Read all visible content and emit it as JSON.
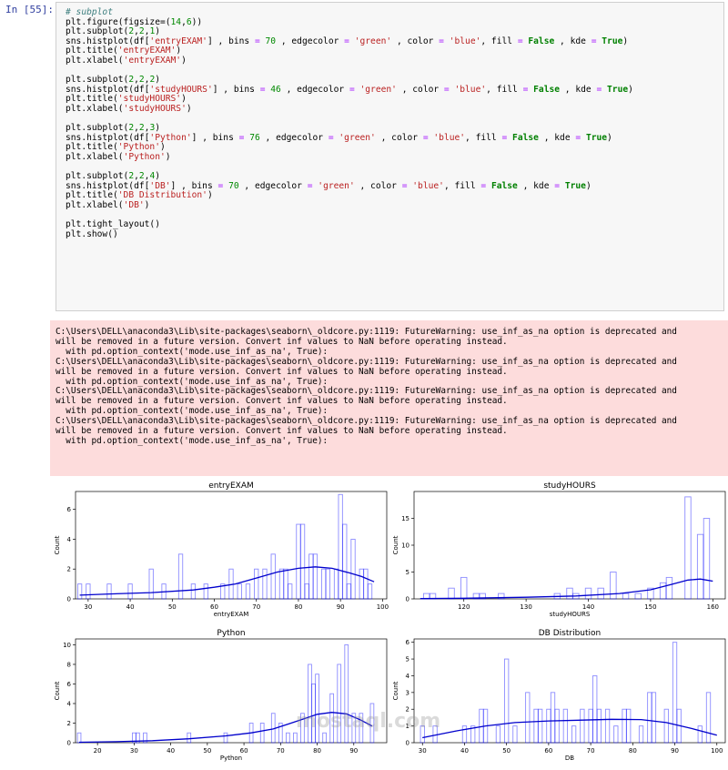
{
  "cell": {
    "prompt": "In [55]:",
    "code_lines": [
      "# subplot",
      "plt.figure(figsize=(14,6))",
      "plt.subplot(2,2,1)",
      "sns.histplot(df['entryEXAM'] , bins = 70 , edgecolor = 'green' , color = 'blue', fill = False , kde = True)",
      "plt.title('entryEXAM')",
      "plt.xlabel('entryEXAM')",
      "",
      "plt.subplot(2,2,2)",
      "sns.histplot(df['studyHOURS'] , bins = 46 , edgecolor = 'green' , color = 'blue', fill = False , kde = True)",
      "plt.title('studyHOURS')",
      "plt.xlabel('studyHOURS')",
      "",
      "plt.subplot(2,2,3)",
      "sns.histplot(df['Python'] , bins = 76 , edgecolor = 'green' , color = 'blue', fill = False , kde = True)",
      "plt.title('Python')",
      "plt.xlabel('Python')",
      "",
      "plt.subplot(2,2,4)",
      "sns.histplot(df['DB'] , bins = 70 , edgecolor = 'green' , color = 'blue', fill = False , kde = True)",
      "plt.title('DB Distribution')",
      "plt.xlabel('DB')",
      "",
      "plt.tight_layout()",
      "plt.show()"
    ]
  },
  "warnings": [
    "C:\\Users\\DELL\\anaconda3\\Lib\\site-packages\\seaborn\\_oldcore.py:1119: FutureWarning: use_inf_as_na option is deprecated and",
    "will be removed in a future version. Convert inf values to NaN before operating instead.",
    "  with pd.option_context('mode.use_inf_as_na', True):",
    "C:\\Users\\DELL\\anaconda3\\Lib\\site-packages\\seaborn\\_oldcore.py:1119: FutureWarning: use_inf_as_na option is deprecated and",
    "will be removed in a future version. Convert inf values to NaN before operating instead.",
    "  with pd.option_context('mode.use_inf_as_na', True):",
    "C:\\Users\\DELL\\anaconda3\\Lib\\site-packages\\seaborn\\_oldcore.py:1119: FutureWarning: use_inf_as_na option is deprecated and",
    "will be removed in a future version. Convert inf values to NaN before operating instead.",
    "  with pd.option_context('mode.use_inf_as_na', True):",
    "C:\\Users\\DELL\\anaconda3\\Lib\\site-packages\\seaborn\\_oldcore.py:1119: FutureWarning: use_inf_as_na option is deprecated and",
    "will be removed in a future version. Convert inf values to NaN before operating instead.",
    "  with pd.option_context('mode.use_inf_as_na', True):"
  ],
  "watermark": "mostaql.com",
  "colors": {
    "bar_edge": "#0000ff",
    "kde": "#0000cc",
    "warning_bg": "#fddcdc"
  },
  "chart_data": [
    {
      "type": "bar",
      "title": "entryEXAM",
      "xlabel": "entryEXAM",
      "ylabel": "Count",
      "xlim": [
        27,
        101
      ],
      "ylim": [
        0,
        7.2
      ],
      "xticks": [
        30,
        40,
        50,
        60,
        70,
        80,
        90,
        100
      ],
      "yticks": [
        0,
        2,
        4,
        6
      ],
      "bars": [
        [
          28,
          1
        ],
        [
          30,
          1
        ],
        [
          35,
          1
        ],
        [
          40,
          1
        ],
        [
          45,
          2
        ],
        [
          48,
          1
        ],
        [
          52,
          3
        ],
        [
          55,
          1
        ],
        [
          58,
          1
        ],
        [
          62,
          1
        ],
        [
          64,
          2
        ],
        [
          66,
          1
        ],
        [
          68,
          1
        ],
        [
          70,
          2
        ],
        [
          72,
          2
        ],
        [
          74,
          3
        ],
        [
          76,
          2
        ],
        [
          77,
          2
        ],
        [
          78,
          1
        ],
        [
          80,
          5
        ],
        [
          81,
          5
        ],
        [
          82,
          1
        ],
        [
          83,
          3
        ],
        [
          84,
          3
        ],
        [
          86,
          2
        ],
        [
          87,
          2
        ],
        [
          89,
          2
        ],
        [
          90,
          7
        ],
        [
          91,
          5
        ],
        [
          92,
          1
        ],
        [
          93,
          4
        ],
        [
          95,
          2
        ],
        [
          96,
          2
        ],
        [
          97,
          1
        ]
      ],
      "kde": [
        [
          28,
          0.25
        ],
        [
          35,
          0.33
        ],
        [
          45,
          0.42
        ],
        [
          55,
          0.6
        ],
        [
          60,
          0.78
        ],
        [
          65,
          1.0
        ],
        [
          70,
          1.4
        ],
        [
          75,
          1.8
        ],
        [
          80,
          2.05
        ],
        [
          84,
          2.15
        ],
        [
          88,
          2.05
        ],
        [
          92,
          1.75
        ],
        [
          95,
          1.5
        ],
        [
          98,
          1.15
        ]
      ]
    },
    {
      "type": "bar",
      "title": "studyHOURS",
      "xlabel": "studyHOURS",
      "ylabel": "Count",
      "xlim": [
        112,
        162
      ],
      "ylim": [
        0,
        20
      ],
      "xticks": [
        120,
        130,
        140,
        150,
        160
      ],
      "yticks": [
        0,
        5,
        10,
        15
      ],
      "bars": [
        [
          114,
          1
        ],
        [
          115,
          1
        ],
        [
          118,
          2
        ],
        [
          120,
          4
        ],
        [
          122,
          1
        ],
        [
          123,
          1
        ],
        [
          126,
          1
        ],
        [
          135,
          1
        ],
        [
          137,
          2
        ],
        [
          138,
          1
        ],
        [
          140,
          2
        ],
        [
          142,
          2
        ],
        [
          144,
          5
        ],
        [
          146,
          1
        ],
        [
          148,
          1
        ],
        [
          150,
          2
        ],
        [
          152,
          3
        ],
        [
          153,
          4
        ],
        [
          156,
          19
        ],
        [
          158,
          12
        ],
        [
          159,
          15
        ]
      ],
      "kde": [
        [
          113,
          0.05
        ],
        [
          120,
          0.12
        ],
        [
          130,
          0.3
        ],
        [
          138,
          0.55
        ],
        [
          145,
          1.0
        ],
        [
          150,
          1.7
        ],
        [
          153,
          2.6
        ],
        [
          156,
          3.5
        ],
        [
          158,
          3.7
        ],
        [
          160,
          3.3
        ]
      ]
    },
    {
      "type": "bar",
      "title": "Python",
      "xlabel": "Python",
      "ylabel": "Count",
      "xlim": [
        14,
        99
      ],
      "ylim": [
        0,
        10.6
      ],
      "xticks": [
        20,
        30,
        40,
        50,
        60,
        70,
        80,
        90
      ],
      "yticks": [
        0,
        2,
        4,
        6,
        8,
        10
      ],
      "bars": [
        [
          15,
          1
        ],
        [
          30,
          1
        ],
        [
          31,
          1
        ],
        [
          33,
          1
        ],
        [
          45,
          1
        ],
        [
          55,
          1
        ],
        [
          62,
          2
        ],
        [
          65,
          2
        ],
        [
          68,
          3
        ],
        [
          70,
          2
        ],
        [
          72,
          1
        ],
        [
          74,
          1
        ],
        [
          76,
          3
        ],
        [
          78,
          8
        ],
        [
          79,
          6
        ],
        [
          80,
          7
        ],
        [
          82,
          1
        ],
        [
          84,
          5
        ],
        [
          86,
          8
        ],
        [
          88,
          10
        ],
        [
          90,
          3
        ],
        [
          92,
          3
        ],
        [
          95,
          4
        ]
      ],
      "kde": [
        [
          15,
          0.05
        ],
        [
          25,
          0.1
        ],
        [
          35,
          0.2
        ],
        [
          45,
          0.4
        ],
        [
          55,
          0.7
        ],
        [
          62,
          1.0
        ],
        [
          68,
          1.4
        ],
        [
          72,
          1.9
        ],
        [
          76,
          2.4
        ],
        [
          80,
          2.9
        ],
        [
          84,
          3.1
        ],
        [
          88,
          2.95
        ],
        [
          92,
          2.3
        ],
        [
          95,
          1.7
        ]
      ]
    },
    {
      "type": "bar",
      "title": "DB Distribution",
      "xlabel": "DB",
      "ylabel": "Count",
      "xlim": [
        28,
        102
      ],
      "ylim": [
        0,
        6.2
      ],
      "xticks": [
        30,
        40,
        50,
        60,
        70,
        80,
        90,
        100
      ],
      "yticks": [
        0,
        1,
        2,
        3,
        4,
        5,
        6
      ],
      "bars": [
        [
          30,
          1
        ],
        [
          33,
          1
        ],
        [
          40,
          1
        ],
        [
          42,
          1
        ],
        [
          44,
          2
        ],
        [
          45,
          2
        ],
        [
          48,
          1
        ],
        [
          50,
          5
        ],
        [
          52,
          1
        ],
        [
          55,
          3
        ],
        [
          57,
          2
        ],
        [
          58,
          2
        ],
        [
          60,
          2
        ],
        [
          61,
          3
        ],
        [
          62,
          2
        ],
        [
          64,
          2
        ],
        [
          66,
          1
        ],
        [
          68,
          2
        ],
        [
          70,
          2
        ],
        [
          71,
          4
        ],
        [
          72,
          2
        ],
        [
          74,
          2
        ],
        [
          76,
          1
        ],
        [
          78,
          2
        ],
        [
          79,
          2
        ],
        [
          82,
          1
        ],
        [
          84,
          3
        ],
        [
          85,
          3
        ],
        [
          88,
          2
        ],
        [
          90,
          6
        ],
        [
          91,
          2
        ],
        [
          96,
          1
        ],
        [
          98,
          3
        ]
      ],
      "kde": [
        [
          30,
          0.3
        ],
        [
          38,
          0.7
        ],
        [
          45,
          1.0
        ],
        [
          52,
          1.2
        ],
        [
          60,
          1.3
        ],
        [
          68,
          1.35
        ],
        [
          75,
          1.4
        ],
        [
          82,
          1.38
        ],
        [
          88,
          1.2
        ],
        [
          94,
          0.85
        ],
        [
          100,
          0.45
        ]
      ]
    }
  ]
}
